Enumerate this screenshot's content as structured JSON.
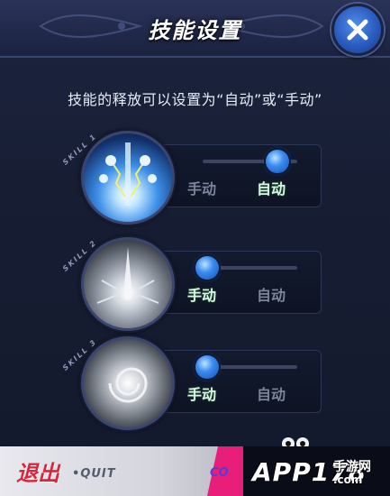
{
  "dialog": {
    "title": "技能设置",
    "description": "技能的释放可以设置为“自动”或“手动”"
  },
  "skills": [
    {
      "tag": "SKILL 1",
      "manual_label": "手动",
      "auto_label": "自动",
      "mode": "auto"
    },
    {
      "tag": "SKILL 2",
      "manual_label": "手动",
      "auto_label": "自动",
      "mode": "manual"
    },
    {
      "tag": "SKILL 3",
      "manual_label": "手动",
      "auto_label": "自动",
      "mode": "manual"
    }
  ],
  "footer": {
    "quit_label": "退出",
    "quit_sub": "QUIT",
    "partial_label": "CO"
  },
  "watermark": {
    "brand": "APP178",
    "brand_cn": "手游网",
    "url": ".com"
  },
  "colors": {
    "accent_blue": "#3a8cf0",
    "active_label": "#d9f7e0",
    "inactive_label": "#7c849c",
    "quit_red": "#e0223a",
    "pink": "#e81e7a"
  }
}
